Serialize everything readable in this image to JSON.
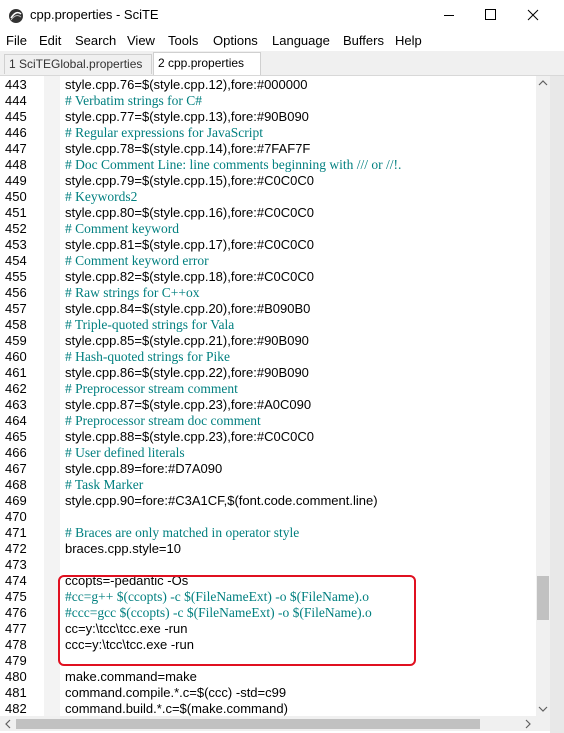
{
  "window": {
    "title": "cpp.properties - SciTE",
    "icons": {
      "app": "scite-app-icon",
      "minimize": "minimize-icon",
      "maximize": "maximize-icon",
      "close": "close-icon"
    }
  },
  "menu": [
    "File",
    "Edit",
    "Search",
    "View",
    "Tools",
    "Options",
    "Language",
    "Buffers",
    "Help"
  ],
  "tabs": [
    {
      "label": "1 SciTEGlobal.properties",
      "active": false
    },
    {
      "label": "2 cpp.properties",
      "active": true
    }
  ],
  "colors": {
    "comment": "#007f7f",
    "annotation_box": "#e01020",
    "text": "#000000"
  },
  "lines": [
    {
      "n": "443",
      "text": "style.cpp.76=$(style.cpp.12),fore:#000000",
      "kind": "normal"
    },
    {
      "n": "444",
      "text": "# Verbatim strings for C#",
      "kind": "comment"
    },
    {
      "n": "445",
      "text": "style.cpp.77=$(style.cpp.13),fore:#90B090",
      "kind": "normal"
    },
    {
      "n": "446",
      "text": "# Regular expressions for JavaScript",
      "kind": "comment"
    },
    {
      "n": "447",
      "text": "style.cpp.78=$(style.cpp.14),fore:#7FAF7F",
      "kind": "normal"
    },
    {
      "n": "448",
      "text": "# Doc Comment Line: line comments beginning with /// or //!.",
      "kind": "comment"
    },
    {
      "n": "449",
      "text": "style.cpp.79=$(style.cpp.15),fore:#C0C0C0",
      "kind": "normal"
    },
    {
      "n": "450",
      "text": "# Keywords2",
      "kind": "comment"
    },
    {
      "n": "451",
      "text": "style.cpp.80=$(style.cpp.16),fore:#C0C0C0",
      "kind": "normal"
    },
    {
      "n": "452",
      "text": "# Comment keyword",
      "kind": "comment"
    },
    {
      "n": "453",
      "text": "style.cpp.81=$(style.cpp.17),fore:#C0C0C0",
      "kind": "normal"
    },
    {
      "n": "454",
      "text": "# Comment keyword error",
      "kind": "comment"
    },
    {
      "n": "455",
      "text": "style.cpp.82=$(style.cpp.18),fore:#C0C0C0",
      "kind": "normal"
    },
    {
      "n": "456",
      "text": "# Raw strings for C++ox",
      "kind": "comment"
    },
    {
      "n": "457",
      "text": "style.cpp.84=$(style.cpp.20),fore:#B090B0",
      "kind": "normal"
    },
    {
      "n": "458",
      "text": "# Triple-quoted strings for Vala",
      "kind": "comment"
    },
    {
      "n": "459",
      "text": "style.cpp.85=$(style.cpp.21),fore:#90B090",
      "kind": "normal"
    },
    {
      "n": "460",
      "text": "# Hash-quoted strings for Pike",
      "kind": "comment"
    },
    {
      "n": "461",
      "text": "style.cpp.86=$(style.cpp.22),fore:#90B090",
      "kind": "normal"
    },
    {
      "n": "462",
      "text": "# Preprocessor stream comment",
      "kind": "comment"
    },
    {
      "n": "463",
      "text": "style.cpp.87=$(style.cpp.23),fore:#A0C090",
      "kind": "normal"
    },
    {
      "n": "464",
      "text": "# Preprocessor stream doc comment",
      "kind": "comment"
    },
    {
      "n": "465",
      "text": "style.cpp.88=$(style.cpp.23),fore:#C0C0C0",
      "kind": "normal"
    },
    {
      "n": "466",
      "text": "# User defined literals",
      "kind": "comment"
    },
    {
      "n": "467",
      "text": "style.cpp.89=fore:#D7A090",
      "kind": "normal"
    },
    {
      "n": "468",
      "text": "# Task Marker",
      "kind": "comment"
    },
    {
      "n": "469",
      "text": "style.cpp.90=fore:#C3A1CF,$(font.code.comment.line)",
      "kind": "normal"
    },
    {
      "n": "470",
      "text": "",
      "kind": "normal"
    },
    {
      "n": "471",
      "text": "# Braces are only matched in operator style",
      "kind": "comment"
    },
    {
      "n": "472",
      "text": "braces.cpp.style=10",
      "kind": "normal"
    },
    {
      "n": "473",
      "text": "",
      "kind": "normal"
    },
    {
      "n": "474",
      "text": "ccopts=-pedantic -Os",
      "kind": "normal"
    },
    {
      "n": "475",
      "text": "#cc=g++ $(ccopts) -c $(FileNameExt) -o $(FileName).o",
      "kind": "comment"
    },
    {
      "n": "476",
      "text": "#ccc=gcc $(ccopts) -c $(FileNameExt) -o $(FileName).o",
      "kind": "comment"
    },
    {
      "n": "477",
      "text": "cc=y:\\tcc\\tcc.exe -run",
      "kind": "normal"
    },
    {
      "n": "478",
      "text": "ccc=y:\\tcc\\tcc.exe -run",
      "kind": "normal"
    },
    {
      "n": "479",
      "text": "",
      "kind": "normal"
    },
    {
      "n": "480",
      "text": "make.command=make",
      "kind": "normal"
    },
    {
      "n": "481",
      "text": "command.compile.*.c=$(ccc) -std=c99",
      "kind": "normal"
    },
    {
      "n": "482",
      "text": "command.build.*.c=$(make.command)",
      "kind": "normal"
    }
  ]
}
